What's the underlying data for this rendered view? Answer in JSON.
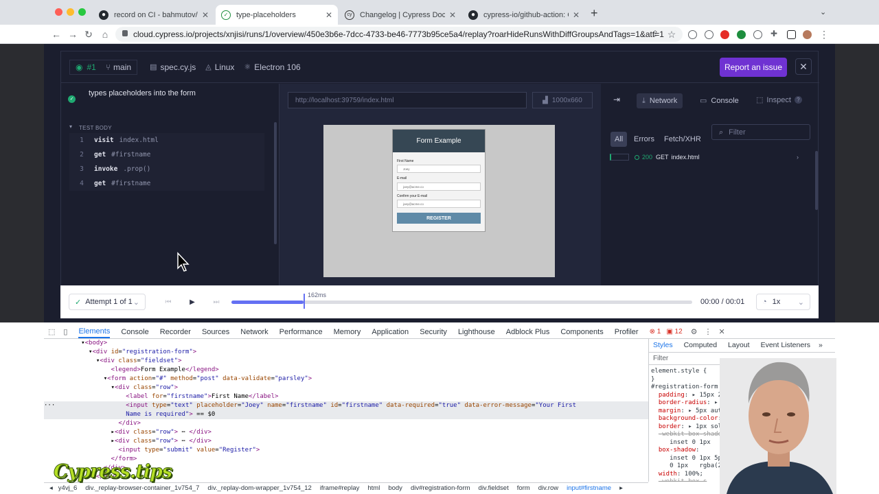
{
  "browser": {
    "tabs": [
      {
        "label": "record on CI - bahmutov/type-",
        "favicon": "github-icon"
      },
      {
        "label": "type-placeholders",
        "favicon": "check-circle-icon",
        "active": true
      },
      {
        "label": "Changelog | Cypress Documen",
        "favicon": "cypress-icon"
      },
      {
        "label": "cypress-io/github-action: GitH",
        "favicon": "github-icon"
      }
    ],
    "url": "cloud.cypress.io/projects/xnjisi/runs/1/overview/450e3b6e-7dcc-4733-be46-7773b95ce5a4/replay?roarHideRunsWithDiffGroupsAndTags=1&att=1"
  },
  "replay": {
    "run_number": "#1",
    "branch": "main",
    "spec": "spec.cy.js",
    "os": "Linux",
    "browser": "Electron 106",
    "report_label": "Report an issue",
    "test_title": "types placeholders into the form",
    "section_label": "TEST BODY",
    "commands": [
      {
        "num": "1",
        "cmd": "visit",
        "arg": "index.html"
      },
      {
        "num": "2",
        "cmd": "get",
        "arg": "#firstname"
      },
      {
        "num": "3",
        "cmd": "invoke",
        "arg": ".prop()"
      },
      {
        "num": "4",
        "cmd": "get",
        "arg": "#firstname"
      }
    ],
    "aut_url": "http://localhost:39759/index.html",
    "viewport": "1000x660",
    "form": {
      "title": "Form Example",
      "first_name_label": "First Name",
      "first_name_value": "Joey",
      "email_label": "E-mail",
      "email_value": "joey@acme.co",
      "confirm_label": "Confirm your E-mail",
      "confirm_value": "joey@acme.co",
      "button": "REGISTER"
    },
    "right_tabs": {
      "network": "Network",
      "console": "Console",
      "inspect": "Inspect"
    },
    "filters": [
      "All",
      "Errors",
      "Fetch/XHR"
    ],
    "filter_placeholder": "Filter",
    "request": {
      "status": "200",
      "method": "GET",
      "file": "index.html"
    },
    "attempt": "Attempt 1 of 1",
    "marker": "162ms",
    "time": "00:00 / 00:01",
    "speed": "1x",
    "progress": 0.156
  },
  "devtools": {
    "tabs": [
      "Elements",
      "Console",
      "Recorder",
      "Sources",
      "Network",
      "Performance",
      "Memory",
      "Application",
      "Security",
      "Lighthouse",
      "Adblock Plus",
      "Components",
      "Profiler"
    ],
    "errors": "1",
    "warnings": "12",
    "style_tabs": [
      "Styles",
      "Computed",
      "Layout",
      "Event Listeners"
    ],
    "style_filter": "Filter",
    "breadcrumbs": [
      "y4vj_6",
      "div._replay-browser-container_1v754_7",
      "div._replay-dom-wrapper_1v754_12",
      "iframe#replay",
      "html",
      "body",
      "div#registration-form",
      "div.fieldset",
      "form",
      "div.row",
      "input#firstname"
    ]
  },
  "logo": "Cypress.tips"
}
